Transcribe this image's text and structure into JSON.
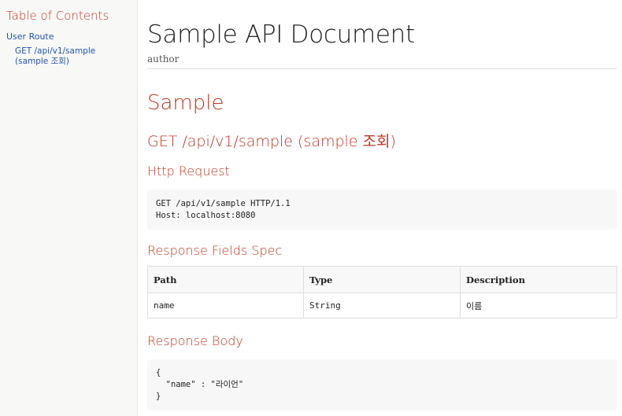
{
  "toc": {
    "title": "Table of Contents",
    "items": [
      {
        "label": "User Route"
      },
      {
        "label": "GET /api/v1/sample (sample 조회)"
      }
    ]
  },
  "doc": {
    "title": "Sample API Document",
    "author": "author"
  },
  "section": {
    "title": "Sample",
    "endpoint_title": "GET /api/v1/sample (sample 조회)",
    "http_request": {
      "heading": "Http Request",
      "code": "GET /api/v1/sample HTTP/1.1\nHost: localhost:8080"
    },
    "response_fields": {
      "heading": "Response Fields Spec",
      "columns": [
        "Path",
        "Type",
        "Description"
      ],
      "rows": [
        {
          "path": "name",
          "type": "String",
          "description": "이름"
        }
      ]
    },
    "response_body": {
      "heading": "Response Body",
      "code": "{\n  \"name\" : \"라이언\"\n}"
    }
  }
}
